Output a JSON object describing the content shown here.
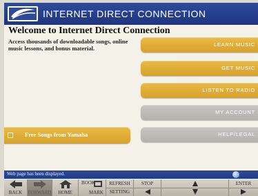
{
  "app": {
    "title": "INTERNET DIRECT CONNECTION"
  },
  "page": {
    "title": "Welcome to Internet Direct Connection",
    "description": "Access thousands of downloadable songs, online music lessons, and bonus material."
  },
  "menu": [
    {
      "label": "LEARN MUSIC",
      "style": "gold"
    },
    {
      "label": "GET MUSIC",
      "style": "gold"
    },
    {
      "label": "LISTEN TO RADIO",
      "style": "gold"
    },
    {
      "label": "MY ACCOUNT",
      "style": "grey"
    },
    {
      "label": "HELP/LEGAL",
      "style": "grey"
    }
  ],
  "free_songs": {
    "label": "Free Songs from Yamaha"
  },
  "status": {
    "text": "Web page has been displayed."
  },
  "toolbar": {
    "back": "BACK",
    "forward": "FORWARD",
    "home": "HOME",
    "bookmark_top": "BOOK",
    "bookmark_bottom": "MARK",
    "refresh": "REFRESH",
    "setting": "SETTING",
    "stop": "STOP",
    "enter": "ENTER"
  },
  "colors": {
    "header_blue": "#26408e",
    "button_gold": "#e0ae38",
    "button_grey": "#bdbbb5"
  }
}
